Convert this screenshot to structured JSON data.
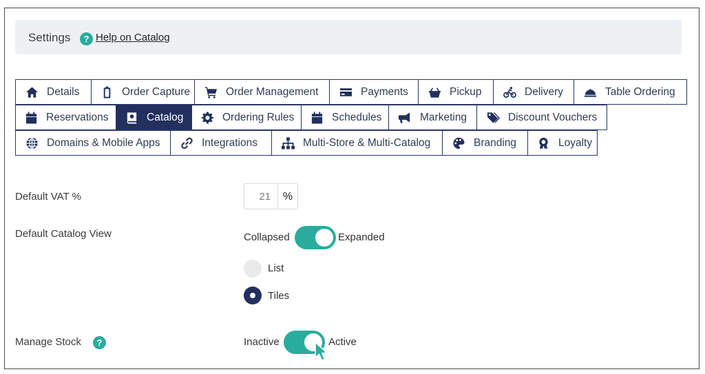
{
  "settings": {
    "title": "Settings",
    "help_badge": "?",
    "help_link": "Help on Catalog"
  },
  "tabs": [
    {
      "label": "Details",
      "icon": "home-icon"
    },
    {
      "label": "Order Capture",
      "icon": "clipboard-icon"
    },
    {
      "label": "Order Management",
      "icon": "cart-icon"
    },
    {
      "label": "Payments",
      "icon": "credit-card-icon"
    },
    {
      "label": "Pickup",
      "icon": "basket-icon"
    },
    {
      "label": "Delivery",
      "icon": "bicycle-icon"
    },
    {
      "label": "Table Ordering",
      "icon": "cloche-icon"
    },
    {
      "label": "Reservations",
      "icon": "calendar-icon"
    },
    {
      "label": "Catalog",
      "icon": "book-icon",
      "active": true
    },
    {
      "label": "Ordering Rules",
      "icon": "gear-icon"
    },
    {
      "label": "Schedules",
      "icon": "calendar-icon"
    },
    {
      "label": "Marketing",
      "icon": "megaphone-icon"
    },
    {
      "label": "Discount Vouchers",
      "icon": "tags-icon"
    },
    {
      "label": "Domains & Mobile Apps",
      "icon": "globe-icon"
    },
    {
      "label": "Integrations",
      "icon": "link-icon"
    },
    {
      "label": "Multi-Store & Multi-Catalog",
      "icon": "sitemap-icon"
    },
    {
      "label": "Branding",
      "icon": "palette-icon"
    },
    {
      "label": "Loyalty",
      "icon": "award-icon"
    }
  ],
  "form": {
    "vat": {
      "label": "Default VAT %",
      "value": "21",
      "unit": "%"
    },
    "catalog_view": {
      "label": "Default Catalog View",
      "off_label": "Collapsed",
      "on_label": "Expanded",
      "enabled": true
    },
    "view_options": [
      {
        "label": "List",
        "selected": false
      },
      {
        "label": "Tiles",
        "selected": true
      }
    ],
    "manage_stock": {
      "label": "Manage Stock",
      "help_badge": "?",
      "off_label": "Inactive",
      "on_label": "Active",
      "enabled": true
    }
  },
  "colors": {
    "accent": "#29ac9d",
    "nav": "#22305e",
    "header_bg": "#eef1f4"
  }
}
